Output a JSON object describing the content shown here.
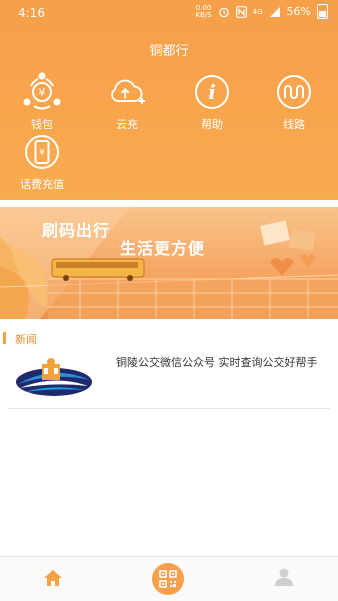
{
  "status_bar": {
    "time": "4:16",
    "speed_value": "0.00",
    "speed_unit": "KB/S",
    "network": "4G",
    "battery": "56%"
  },
  "header": {
    "title": "铜都行"
  },
  "menu": [
    {
      "label": "钱包",
      "icon": "wallet-share-icon"
    },
    {
      "label": "云充",
      "icon": "cloud-upload-icon"
    },
    {
      "label": "帮助",
      "icon": "info-icon"
    },
    {
      "label": "线路",
      "icon": "route-icon"
    },
    {
      "label": "话费充值",
      "icon": "phone-recharge-icon"
    }
  ],
  "banner": {
    "line1": "刷码出行",
    "line2": "生活更方便"
  },
  "news": {
    "section_title": "新闻",
    "items": [
      {
        "title": "铜陵公交微信公众号 实时查询公交好帮手"
      }
    ]
  },
  "bottom_nav": {
    "items": [
      "home-icon",
      "qr-scan-icon",
      "user-icon"
    ],
    "active_color": "#f7a04a",
    "inactive_color": "#cfcfcf"
  },
  "colors": {
    "brand_orange": "#f7a04a",
    "news_title": "#f08a2d"
  }
}
